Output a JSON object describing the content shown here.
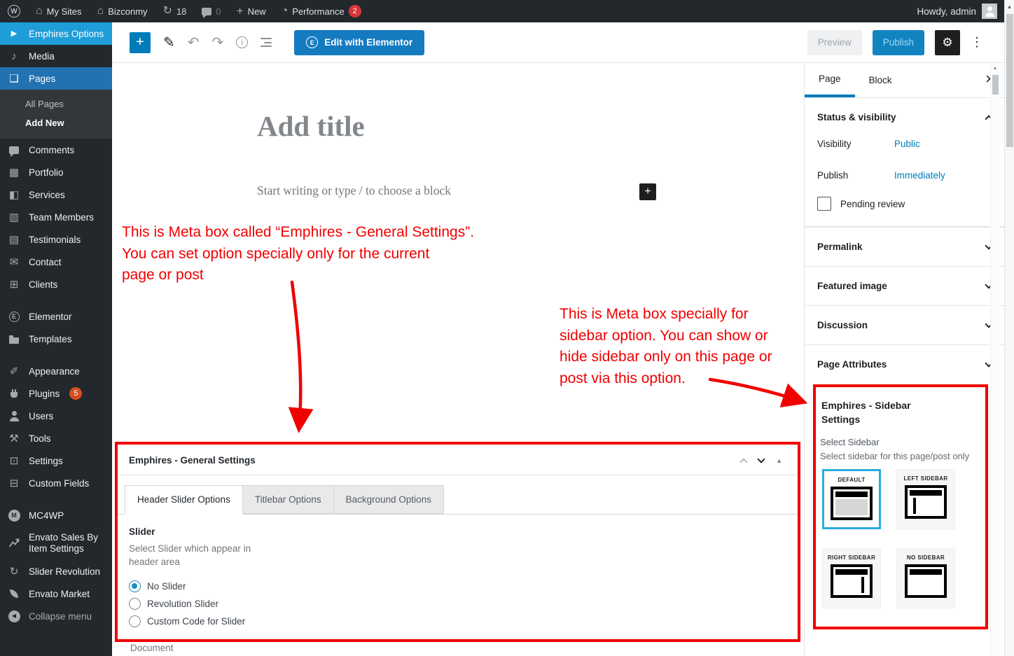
{
  "admin_bar": {
    "my_sites": "My Sites",
    "site_name": "Bizconmy",
    "updates_count": "18",
    "comments_count": "0",
    "new_label": "New",
    "performance_label": "Performance",
    "performance_badge": "2",
    "howdy": "Howdy, admin"
  },
  "menu": {
    "items": [
      {
        "label": "Emphires Options",
        "icon": "play-icon",
        "state": "highlight"
      },
      {
        "label": "Media",
        "icon": "media-icon"
      },
      {
        "label": "Pages",
        "icon": "pages-icon",
        "state": "active",
        "submenu": [
          {
            "label": "All Pages"
          },
          {
            "label": "Add New",
            "current": true
          }
        ]
      },
      {
        "label": "Comments",
        "icon": "comments-icon"
      },
      {
        "label": "Portfolio",
        "icon": "portfolio-icon"
      },
      {
        "label": "Services",
        "icon": "services-icon"
      },
      {
        "label": "Team Members",
        "icon": "team-members-icon"
      },
      {
        "label": "Testimonials",
        "icon": "testimonials-icon"
      },
      {
        "label": "Contact",
        "icon": "contact-icon"
      },
      {
        "label": "Clients",
        "icon": "clients-icon"
      },
      {
        "label": "Elementor",
        "icon": "elementor-icon",
        "gap_before": true
      },
      {
        "label": "Templates",
        "icon": "templates-icon"
      },
      {
        "label": "Appearance",
        "icon": "appearance-icon",
        "gap_before": true
      },
      {
        "label": "Plugins",
        "icon": "plugins-icon",
        "badge": "5"
      },
      {
        "label": "Users",
        "icon": "users-icon"
      },
      {
        "label": "Tools",
        "icon": "tools-icon"
      },
      {
        "label": "Settings",
        "icon": "settings-icon"
      },
      {
        "label": "Custom Fields",
        "icon": "custom-fields-icon"
      },
      {
        "label": "MC4WP",
        "icon": "mc4wp-icon",
        "gap_before": true
      },
      {
        "label": "Envato Sales By Item Settings",
        "icon": "envato-sales-icon",
        "two_line": true
      },
      {
        "label": "Slider Revolution",
        "icon": "slider-revolution-icon"
      },
      {
        "label": "Envato Market",
        "icon": "envato-market-icon"
      },
      {
        "label": "Collapse menu",
        "icon": "collapse-icon",
        "muted": true
      }
    ]
  },
  "editor_header": {
    "edit_with_elementor": "Edit with Elementor",
    "preview": "Preview",
    "publish": "Publish"
  },
  "canvas": {
    "title_placeholder": "Add title",
    "body_placeholder": "Start writing or type / to choose a block",
    "document_label": "Document"
  },
  "annotations": {
    "general": "This is Meta box called “Emphires - General Settings”.\nYou can set option specially only for the current\npage or post",
    "sidebar": "This is Meta box specially for\nsidebar option. You can show or\nhide sidebar only on this page or\npost via this option."
  },
  "general_metabox": {
    "title": "Emphires - General Settings",
    "tabs": [
      {
        "label": "Header Slider Options",
        "active": true
      },
      {
        "label": "Titlebar Options"
      },
      {
        "label": "Background Options"
      }
    ],
    "slider_label": "Slider",
    "slider_desc": "Select Slider which appear in\nheader area",
    "options": [
      {
        "label": "No Slider",
        "selected": true
      },
      {
        "label": "Revolution Slider"
      },
      {
        "label": "Custom Code for Slider"
      }
    ]
  },
  "settings_panel": {
    "page_tab": "Page",
    "block_tab": "Block",
    "status": {
      "title": "Status & visibility",
      "visibility_label": "Visibility",
      "visibility_value": "Public",
      "publish_label": "Publish",
      "publish_value": "Immediately",
      "pending_review": "Pending review"
    },
    "sections": [
      "Permalink",
      "Featured image",
      "Discussion",
      "Page Attributes"
    ]
  },
  "sidebar_metabox": {
    "title": "Emphires - Sidebar Settings",
    "select_label": "Select Sidebar",
    "select_desc": "Select sidebar for this page/post only",
    "options": [
      {
        "label": "DEFAULT",
        "layout": "default",
        "selected": true
      },
      {
        "label": "LEFT SIDEBAR",
        "layout": "left"
      },
      {
        "label": "RIGHT SIDEBAR",
        "layout": "right"
      },
      {
        "label": "NO SIDEBAR",
        "layout": "none"
      }
    ]
  },
  "colors": {
    "admin_accent": "#2271b1",
    "highlight_cyan": "#1e9dd8",
    "link_blue": "#007cba",
    "annotation_red": "#f10000",
    "selected_card_cyan": "#29abe2",
    "plugins_badge": "#d54e21",
    "performance_badge": "#d63638",
    "elementor_button": "#157bc0"
  }
}
